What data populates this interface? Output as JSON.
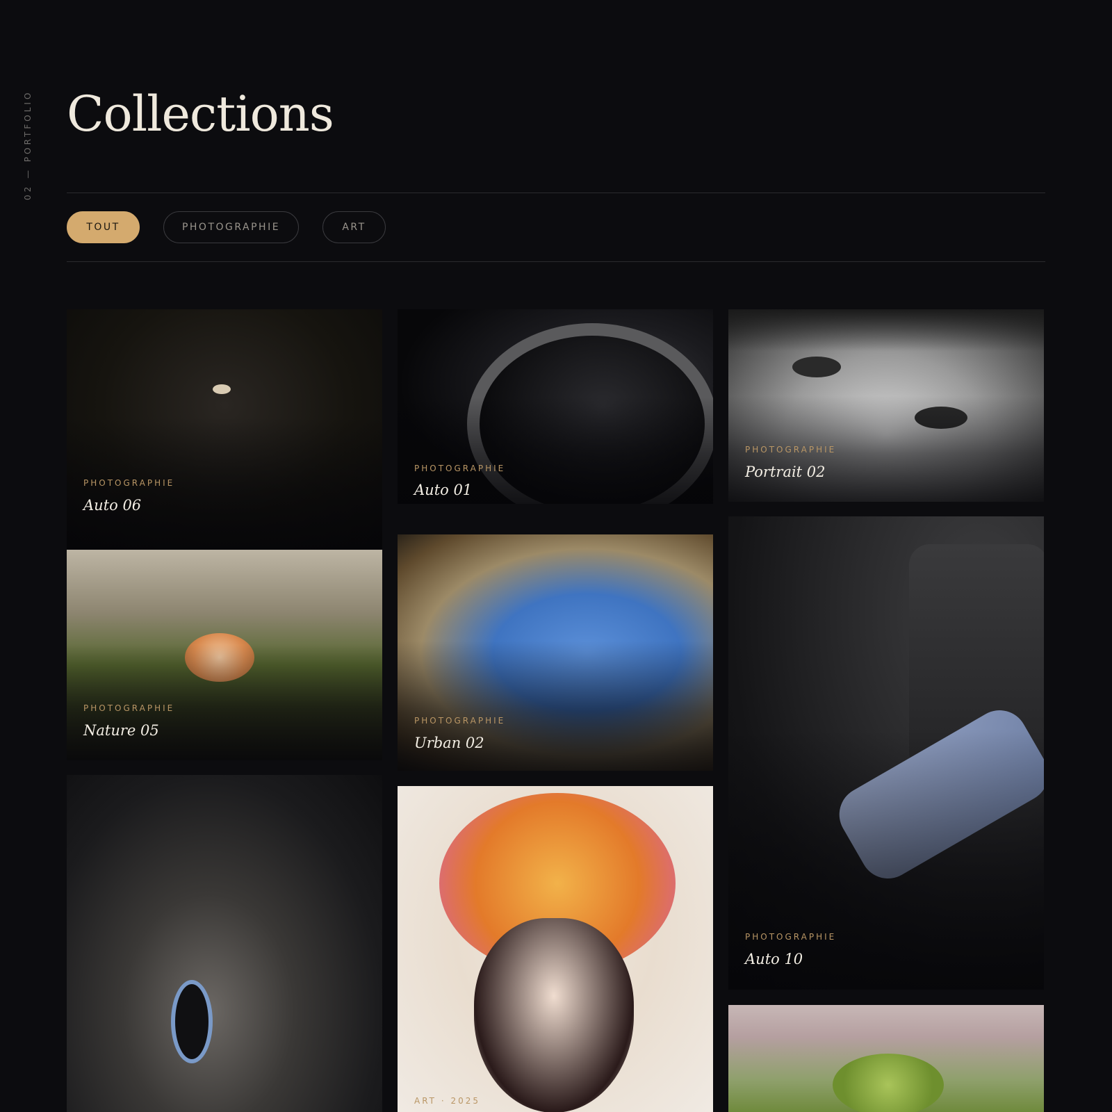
{
  "side_label": "02 — PORTFOLIO",
  "page_title": "Collections",
  "filters": [
    {
      "label": "TOUT",
      "active": true
    },
    {
      "label": "PHOTOGRAPHIE",
      "active": false
    },
    {
      "label": "ART",
      "active": false
    }
  ],
  "cards": [
    {
      "category": "PHOTOGRAPHIE",
      "title": "Auto 06"
    },
    {
      "category": "PHOTOGRAPHIE",
      "title": "Auto 01"
    },
    {
      "category": "PHOTOGRAPHIE",
      "title": "Portrait 02"
    },
    {
      "category": "PHOTOGRAPHIE",
      "title": "Nature 05"
    },
    {
      "category": "PHOTOGRAPHIE",
      "title": "Urban 02"
    },
    {
      "category": "PHOTOGRAPHIE",
      "title": "Auto 10"
    },
    {
      "category": "",
      "title": ""
    },
    {
      "category": "ART · 2025",
      "title": ""
    },
    {
      "category": "",
      "title": ""
    }
  ],
  "colors": {
    "accent": "#d4aa6e",
    "background": "#0c0c0f"
  }
}
